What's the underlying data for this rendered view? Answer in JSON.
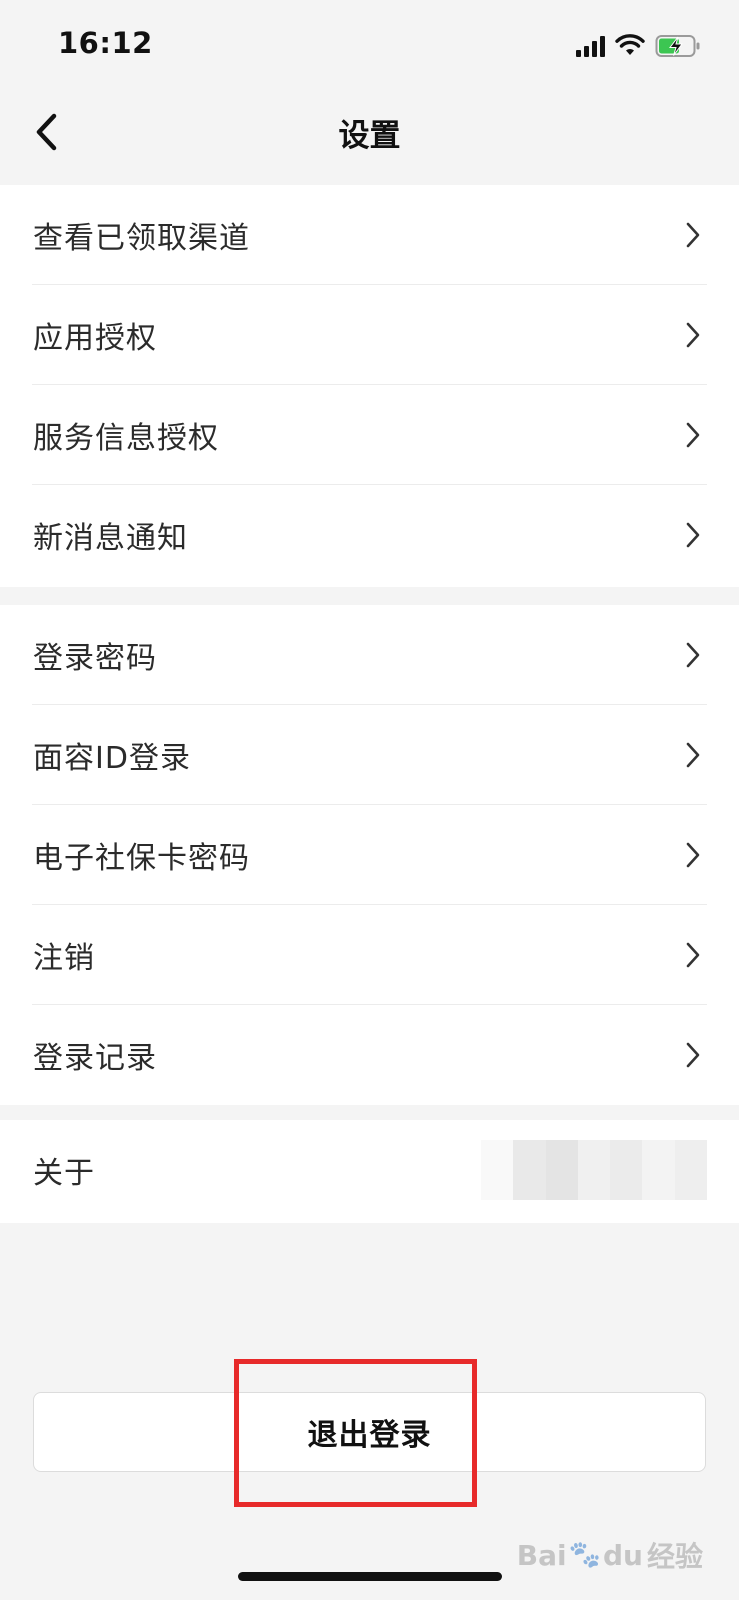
{
  "status_bar": {
    "time": "16:12"
  },
  "nav": {
    "title": "设置"
  },
  "group_1": [
    {
      "label": "查看已领取渠道"
    },
    {
      "label": "应用授权"
    },
    {
      "label": "服务信息授权"
    },
    {
      "label": "新消息通知"
    }
  ],
  "group_2": [
    {
      "label": "登录密码"
    },
    {
      "label": "面容ID登录"
    },
    {
      "label": "电子社保卡密码"
    },
    {
      "label": "注销"
    },
    {
      "label": "登录记录"
    }
  ],
  "group_3": [
    {
      "label": "关于"
    }
  ],
  "logout": {
    "label": "退出登录"
  },
  "watermark": {
    "text_left": "Bai",
    "text_right": "du",
    "cn": "经验"
  },
  "colors": {
    "highlight": "#e72a2a",
    "background": "#f4f4f4"
  }
}
